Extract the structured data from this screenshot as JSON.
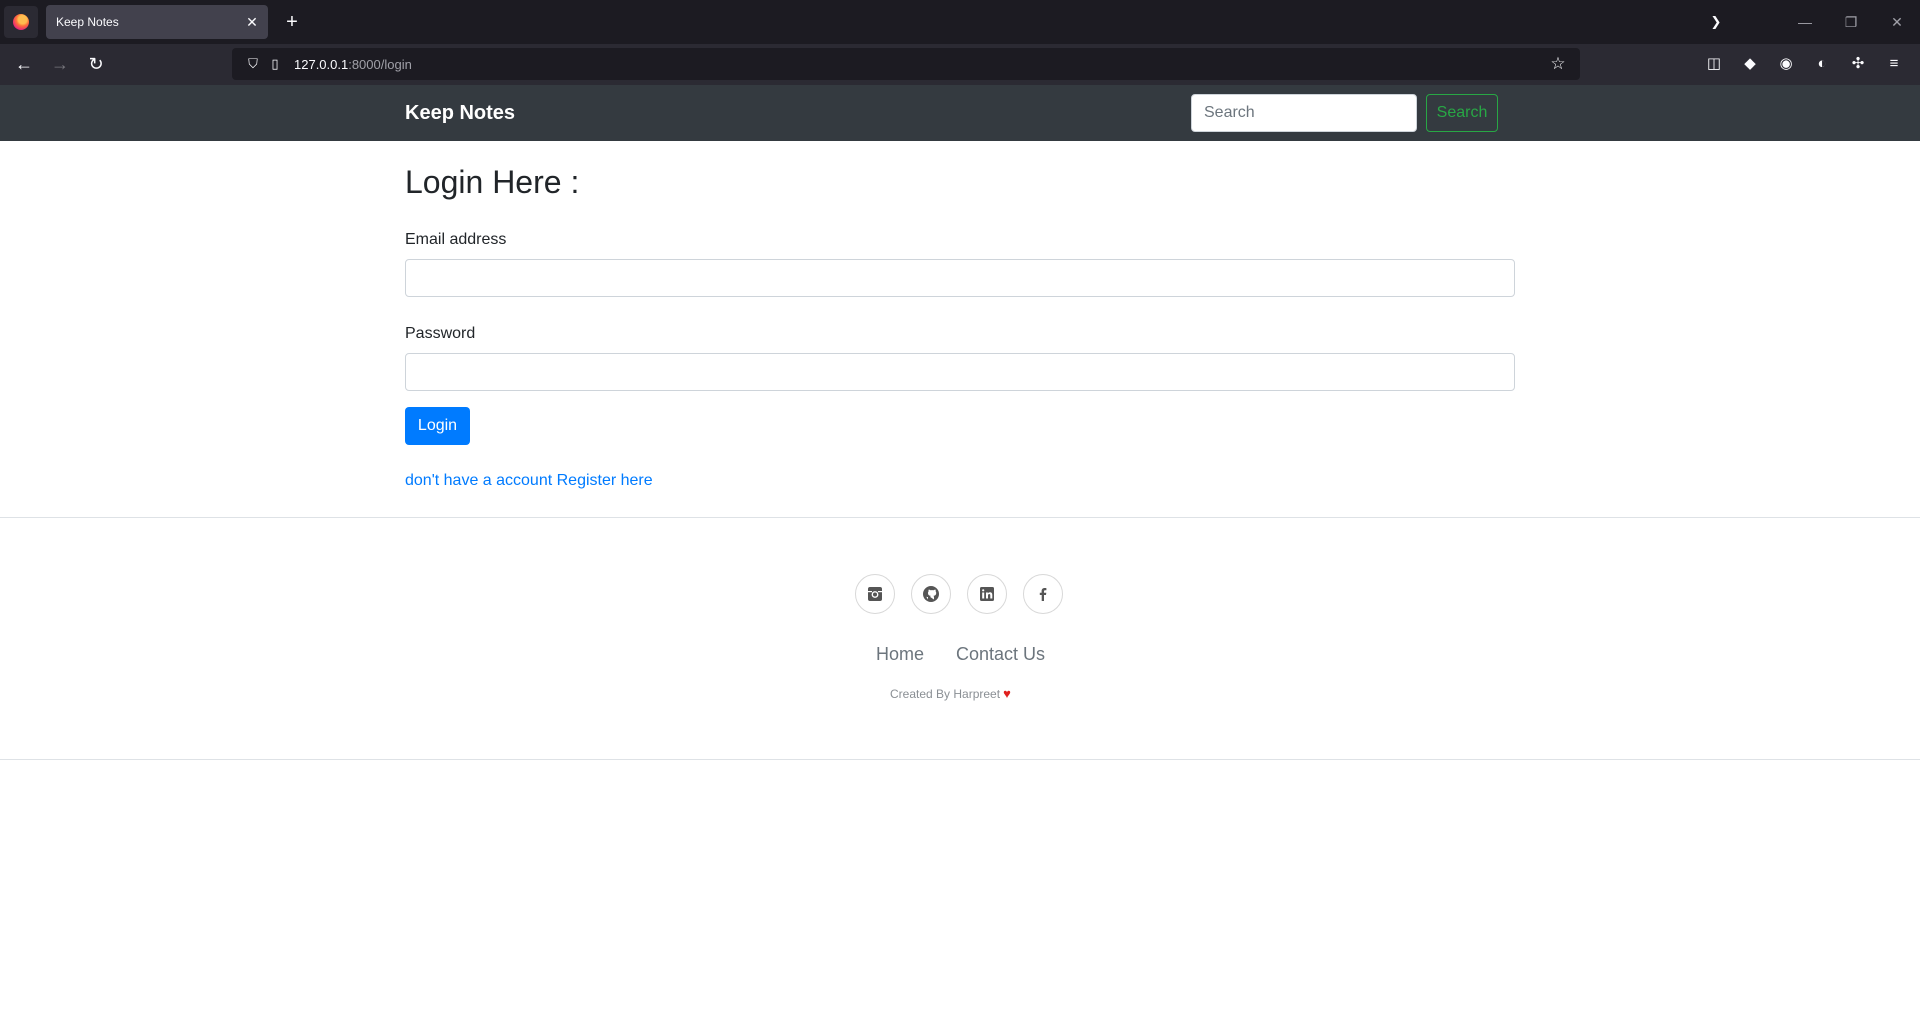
{
  "browser": {
    "tab_title": "Keep Notes",
    "url_host": "127.0.0.1",
    "url_path": ":8000/login"
  },
  "site": {
    "brand": "Keep Notes",
    "search_placeholder": "Search",
    "search_button": "Search"
  },
  "login": {
    "title": "Login Here :",
    "email_label": "Email address",
    "password_label": "Password",
    "submit_label": "Login",
    "register_link": "don't have a account Register here"
  },
  "footer": {
    "social_icons": [
      "instagram-icon",
      "github-icon",
      "linkedin-icon",
      "facebook-icon"
    ],
    "links": [
      "Home",
      "Contact Us"
    ],
    "credit": "Created By Harpreet"
  },
  "colors": {
    "navbar_bg": "#343a40",
    "primary": "#007bff",
    "success": "#28a745"
  }
}
